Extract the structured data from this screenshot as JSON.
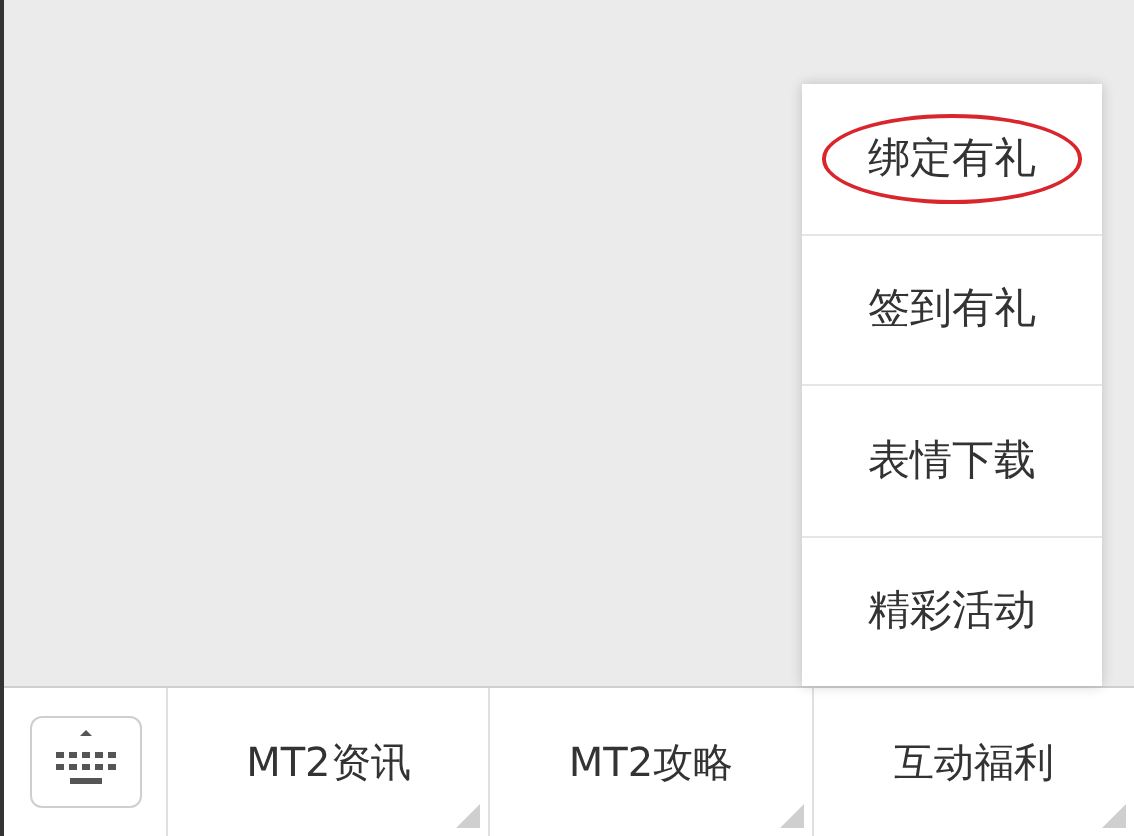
{
  "popup_menu": {
    "items": [
      {
        "label": "绑定有礼",
        "circled": true
      },
      {
        "label": "签到有礼",
        "circled": false
      },
      {
        "label": "表情下载",
        "circled": false
      },
      {
        "label": "精彩活动",
        "circled": false
      }
    ]
  },
  "bottom_bar": {
    "menus": [
      {
        "label": "MT2资讯"
      },
      {
        "label": "MT2攻略"
      },
      {
        "label": "互动福利"
      }
    ]
  }
}
